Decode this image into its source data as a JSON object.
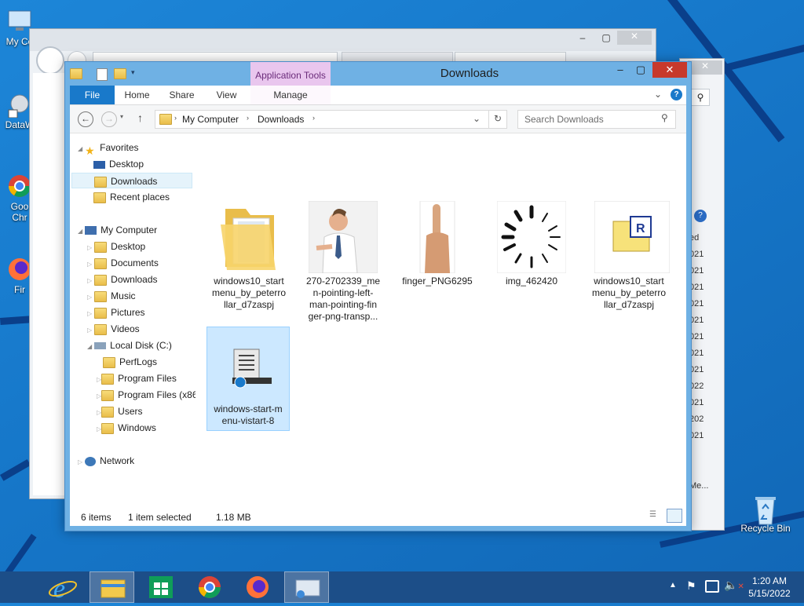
{
  "desktop": {
    "icons": [
      {
        "label": "My Co"
      },
      {
        "label": "DataW"
      },
      {
        "label": "Goo\nChr"
      },
      {
        "label": "Fir"
      },
      {
        "label": "Recycle Bin"
      }
    ]
  },
  "bg_window": {
    "right_list": [
      "ed",
      "021",
      "021",
      "021",
      "021",
      "021",
      "021",
      "021",
      "021",
      "022",
      "021",
      "202",
      "021",
      "Me..."
    ]
  },
  "explorer": {
    "title": "Downloads",
    "contextual_tab": "Application Tools",
    "tabs": [
      "File",
      "Home",
      "Share",
      "View",
      "Manage"
    ],
    "breadcrumb": [
      "My Computer",
      "Downloads"
    ],
    "search_placeholder": "Search Downloads",
    "nav": {
      "favorites_label": "Favorites",
      "favorites": [
        "Desktop",
        "Downloads",
        "Recent places"
      ],
      "computer_label": "My Computer",
      "computer": [
        "Desktop",
        "Documents",
        "Downloads",
        "Music",
        "Pictures",
        "Videos"
      ],
      "disk_label": "Local Disk (C:)",
      "disk": [
        "PerfLogs",
        "Program Files",
        "Program Files (x86",
        "Users",
        "Windows"
      ],
      "network_label": "Network"
    },
    "files": [
      {
        "name": "windows10_start menu_by_peterro llar_d7zaspj",
        "icon": "folder-icon"
      },
      {
        "name": "270-2702339_me n-pointing-left- man-pointing-fin ger-png-transp...",
        "icon": "photo-thumbnail"
      },
      {
        "name": "finger_PNG6295",
        "icon": "photo-thumbnail"
      },
      {
        "name": "img_462420",
        "icon": "loading-spinner-icon"
      },
      {
        "name": "windows10_start menu_by_peterro llar_d7zaspj",
        "icon": "rar-archive-icon"
      },
      {
        "name": "windows-start-m enu-vistart-8",
        "icon": "installer-icon"
      }
    ],
    "status": {
      "items": "6 items",
      "selected": "1 item selected",
      "size": "1.18 MB"
    }
  },
  "taskbar": {
    "time": "1:20 AM",
    "date": "5/15/2022"
  },
  "colors": {
    "accent": "#1979ca",
    "title_active": "#6fb1e4",
    "close": "#c7392b"
  }
}
